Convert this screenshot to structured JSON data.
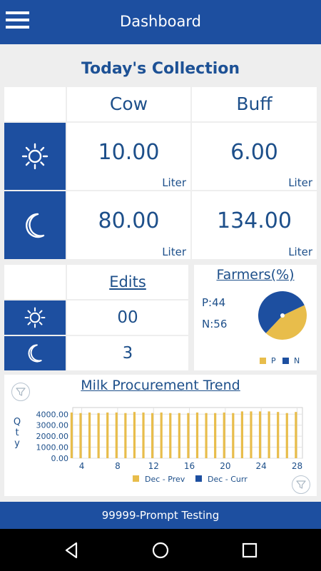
{
  "app": {
    "title": "Dashboard"
  },
  "collection": {
    "title": "Today's Collection",
    "columns": [
      "Cow",
      "Buff"
    ],
    "morning": {
      "cow": "10.00",
      "buff": "6.00"
    },
    "evening": {
      "cow": "80.00",
      "buff": "134.00"
    },
    "unit": "Liter"
  },
  "edits": {
    "title": "Edits",
    "morning": "00",
    "evening": "3"
  },
  "farmers": {
    "title": "Farmers(%)",
    "p_label": "P:44",
    "n_label": "N:56",
    "legend": [
      "P",
      "N"
    ],
    "colors": {
      "P": "#e8bd4b",
      "N": "#1d4fa0"
    }
  },
  "trend": {
    "title": "Milk Procurement Trend",
    "ylabel": "Qty",
    "legend": [
      "Dec - Prev",
      "Dec - Curr"
    ]
  },
  "chart_data": [
    {
      "type": "pie",
      "title": "Farmers(%)",
      "labels": [
        "P",
        "N"
      ],
      "values": [
        44,
        56
      ]
    },
    {
      "type": "bar",
      "title": "Milk Procurement Trend",
      "ylabel": "Qty",
      "x": [
        3,
        4,
        5,
        6,
        7,
        8,
        9,
        10,
        11,
        12,
        13,
        14,
        15,
        16,
        17,
        18,
        19,
        20,
        21,
        22,
        23,
        24,
        25,
        26,
        27,
        28
      ],
      "x_ticks": [
        4,
        8,
        12,
        16,
        20,
        24,
        28
      ],
      "y_ticks": [
        "0.00",
        "1000.00",
        "2000.00",
        "3000.00",
        "4000.00"
      ],
      "ylim": [
        0,
        4600
      ],
      "series": [
        {
          "name": "Dec - Prev",
          "values": [
            4150,
            4100,
            4150,
            4100,
            4150,
            4150,
            4100,
            4200,
            4150,
            4100,
            4150,
            4100,
            4100,
            4100,
            4150,
            4100,
            4100,
            4150,
            4100,
            4250,
            4250,
            4250,
            4250,
            4200,
            4100,
            4200
          ]
        },
        {
          "name": "Dec - Curr",
          "values": [
            0,
            0,
            0,
            0,
            0,
            0,
            0,
            0,
            0,
            0,
            0,
            0,
            0,
            0,
            0,
            0,
            0,
            0,
            0,
            0,
            0,
            0,
            0,
            0,
            0,
            0
          ]
        }
      ],
      "colors": {
        "Dec - Prev": "#e8bd4b",
        "Dec - Curr": "#1d4fa0"
      },
      "legend_position": "bottom",
      "grid": true
    }
  ]
}
